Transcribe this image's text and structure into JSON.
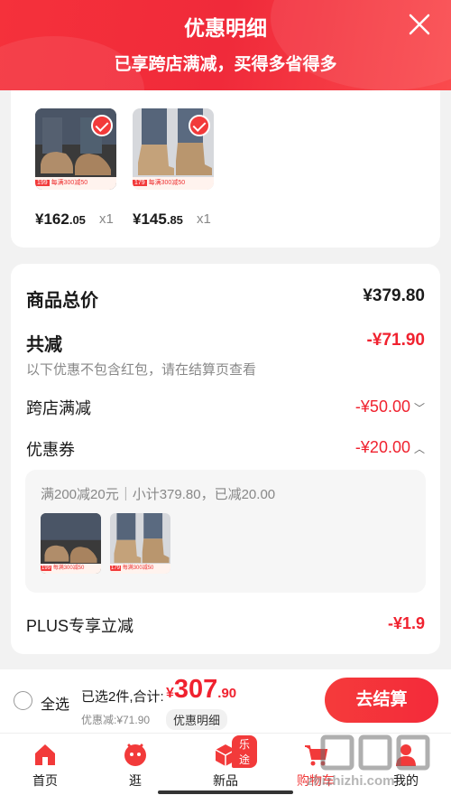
{
  "header": {
    "title": "优惠明细",
    "subtitle": "已享跨店满减，买得多省得多"
  },
  "products": [
    {
      "price_int": "¥162",
      "price_dec": ".05",
      "qty": "x1",
      "tag_price": "199",
      "tag_text": "每满300减50"
    },
    {
      "price_int": "¥145",
      "price_dec": ".85",
      "qty": "x1",
      "tag_price": "179",
      "tag_text": "每满300减50"
    }
  ],
  "summary": {
    "goods_total_label": "商品总价",
    "goods_total_value": "¥379.80",
    "reduction_label": "共减",
    "reduction_value": "-¥71.90",
    "reduction_note": "以下优惠不包含红包，请在结算页查看",
    "cross_store_label": "跨店满减",
    "cross_store_value": "-¥50.00",
    "coupon_label": "优惠券",
    "coupon_value": "-¥20.00",
    "coupon_detail": "满200减20元｜小计379.80，已减20.00",
    "plus_label": "PLUS专享立减",
    "plus_value": "-¥1.9"
  },
  "bottom_bar": {
    "select_all": "全选",
    "selected_summary": "已选2件,合计:",
    "total_yen": "¥",
    "total_int": "307",
    "total_dec": ".90",
    "saved": "优惠减:¥71.90",
    "detail_button": "优惠明细",
    "checkout_button": "去结算"
  },
  "tabs": [
    {
      "label": "首页"
    },
    {
      "label": "逛"
    },
    {
      "label": "新品",
      "badge": "乐途"
    },
    {
      "label": "购物车"
    },
    {
      "label": "我的"
    }
  ],
  "watermark": "zhizhizhi.com",
  "colors": {
    "accent": "#f0222f",
    "header": "#f5313b"
  }
}
